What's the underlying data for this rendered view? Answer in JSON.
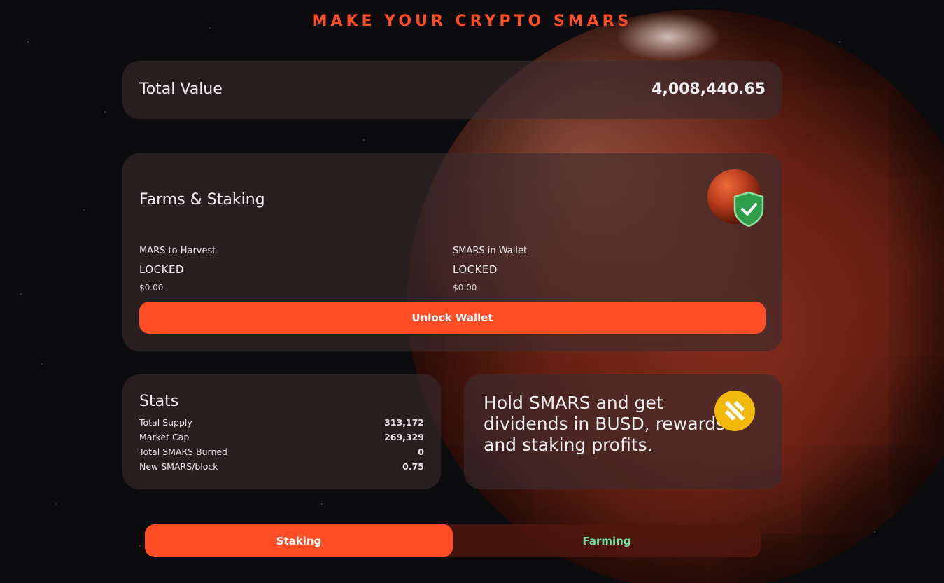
{
  "headline": "MAKE YOUR CRYPTO SMARS",
  "total": {
    "label": "Total Value",
    "value": "4,008,440.65"
  },
  "farms": {
    "title": "Farms & Staking",
    "harvest": {
      "label": "MARS to Harvest",
      "status": "LOCKED",
      "usd": "$0.00"
    },
    "wallet": {
      "label": "SMARS in Wallet",
      "status": "LOCKED",
      "usd": "$0.00"
    },
    "unlock_label": "Unlock Wallet",
    "badge_icon": "mars-shield-check-icon"
  },
  "stats": {
    "title": "Stats",
    "rows": [
      {
        "label": "Total Supply",
        "value": "313,172"
      },
      {
        "label": "Market Cap",
        "value": "269,329"
      },
      {
        "label": "Total SMARS Burned",
        "value": "0"
      },
      {
        "label": "New SMARS/block",
        "value": "0.75"
      }
    ]
  },
  "promo": {
    "text": "Hold SMARS and get dividends in BUSD, rewards and staking profits.",
    "icon": "busd-icon"
  },
  "tabs": {
    "staking": "Staking",
    "farming": "Farming",
    "active": "staking"
  },
  "colors": {
    "accent": "#ff4d25",
    "farming_text": "#6fe0a0",
    "busd_yellow": "#f0b90b"
  }
}
